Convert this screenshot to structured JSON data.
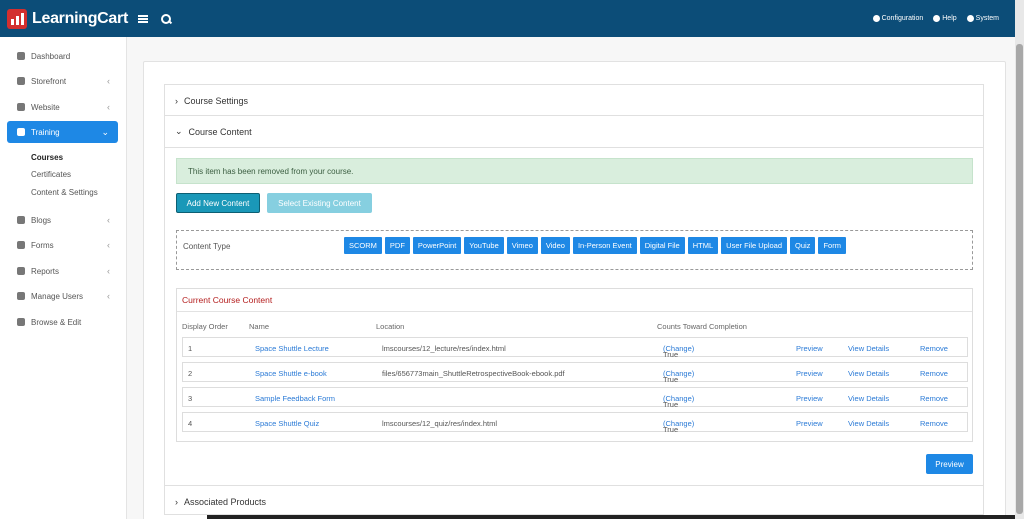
{
  "topbar": {
    "brand": "LearningCart",
    "links": [
      {
        "label": "Configuration",
        "icon": "gear-icon"
      },
      {
        "label": "Help",
        "icon": "help-icon"
      },
      {
        "label": "System",
        "icon": "user-icon"
      }
    ]
  },
  "sidebar": {
    "items": [
      {
        "label": "Dashboard",
        "icon": "dashboard-icon",
        "chevron": ""
      },
      {
        "label": "Storefront",
        "icon": "dollar-icon",
        "chevron": "‹"
      },
      {
        "label": "Website",
        "icon": "website-icon",
        "chevron": "‹"
      },
      {
        "label": "Training",
        "icon": "graduation-cap-icon",
        "chevron": "⌄"
      },
      {
        "label": "Blogs",
        "icon": "blogs-icon",
        "chevron": "‹"
      },
      {
        "label": "Forms",
        "icon": "forms-icon",
        "chevron": "‹"
      },
      {
        "label": "Reports",
        "icon": "chart-icon",
        "chevron": "‹"
      },
      {
        "label": "Manage Users",
        "icon": "users-icon",
        "chevron": "‹"
      },
      {
        "label": "Browse & Edit",
        "icon": "cursor-icon",
        "chevron": ""
      }
    ],
    "subitems": [
      "Courses",
      "Certificates",
      "Content & Settings"
    ]
  },
  "sections": {
    "course_settings": "Course Settings",
    "course_content": "Course Content",
    "associated_products": "Associated Products"
  },
  "alert": "This item has been removed from your course.",
  "buttons": {
    "add_new": "Add New Content",
    "select_existing": "Select Existing Content",
    "preview": "Preview"
  },
  "content_type": {
    "label": "Content Type",
    "types": [
      "SCORM",
      "PDF",
      "PowerPoint",
      "YouTube",
      "Vimeo",
      "Video",
      "In-Person Event",
      "Digital File",
      "HTML",
      "User File Upload",
      "Quiz",
      "Form"
    ]
  },
  "current_content": {
    "title": "Current Course Content",
    "headers": {
      "order": "Display Order",
      "name": "Name",
      "location": "Location",
      "counts": "Counts Toward Completion"
    },
    "rows": [
      {
        "order": "1",
        "name": "Space Shuttle Lecture",
        "location": "lmscourses/12_lecture/res/index.html",
        "counts": "True",
        "change": "(Change)",
        "preview": "Preview",
        "details": "View Details",
        "remove": "Remove"
      },
      {
        "order": "2",
        "name": "Space Shuttle e-book",
        "location": "files/656773main_ShuttleRetrospectiveBook-ebook.pdf",
        "counts": "True",
        "change": "(Change)",
        "preview": "Preview",
        "details": "View Details",
        "remove": "Remove"
      },
      {
        "order": "3",
        "name": "Sample Feedback Form",
        "location": "",
        "counts": "True",
        "change": "(Change)",
        "preview": "Preview",
        "details": "View Details",
        "remove": "Remove"
      },
      {
        "order": "4",
        "name": "Space Shuttle Quiz",
        "location": "lmscourses/12_quiz/res/index.html",
        "counts": "True",
        "change": "(Change)",
        "preview": "Preview",
        "details": "View Details",
        "remove": "Remove"
      }
    ]
  }
}
